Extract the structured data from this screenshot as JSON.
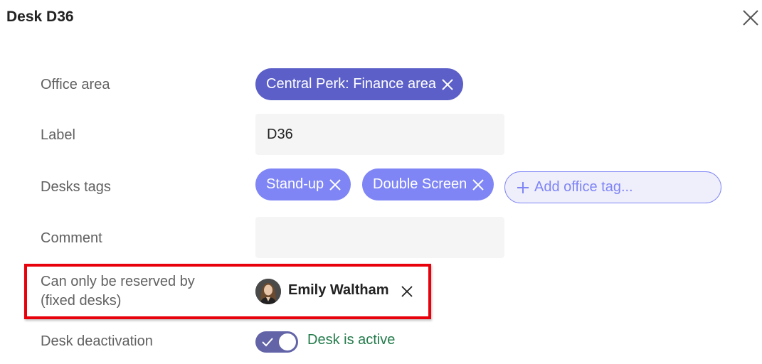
{
  "dialog": {
    "title": "Desk D36"
  },
  "fields": {
    "office_area": {
      "label": "Office area",
      "value": "Central Perk: Finance area"
    },
    "desk_label": {
      "label": "Label",
      "value": "D36"
    },
    "desk_tags": {
      "label": "Desks tags",
      "tags": [
        "Stand-up",
        "Double Screen"
      ],
      "add_placeholder": "Add office tag..."
    },
    "comment": {
      "label": "Comment",
      "value": ""
    },
    "reserved_by": {
      "label_line1": "Can only be reserved by",
      "label_line2": "(fixed desks)",
      "person_name": "Emily Waltham"
    },
    "deactivation": {
      "label": "Desk deactivation",
      "status_text": "Desk is active",
      "active": true
    }
  },
  "colors": {
    "primary_chip": "#5b5fc7",
    "tag_chip": "#7f85f5",
    "toggle_on": "#6264a7",
    "active_text": "#237b4b",
    "highlight_border": "#e8000b"
  },
  "icons": {
    "close": "close-icon",
    "remove": "remove-icon",
    "add": "plus-icon",
    "check": "check-icon"
  }
}
